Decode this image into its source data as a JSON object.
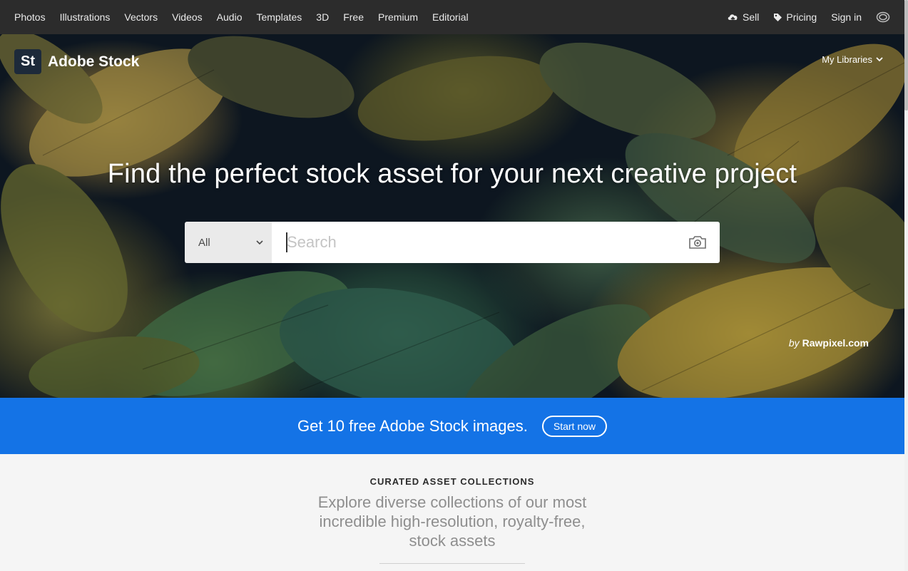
{
  "topnav": {
    "links": [
      "Photos",
      "Illustrations",
      "Vectors",
      "Videos",
      "Audio",
      "Templates",
      "3D",
      "Free",
      "Premium",
      "Editorial"
    ],
    "sell": "Sell",
    "pricing": "Pricing",
    "signin": "Sign in",
    "icons": {
      "sell": "cloud-upload-icon",
      "pricing": "tag-icon",
      "apps": "creative-cloud-icon"
    }
  },
  "brand": {
    "badge": "St",
    "name": "Adobe Stock"
  },
  "hero": {
    "my_libraries": "My Libraries",
    "headline": "Find the perfect stock asset for your next creative project",
    "credit_by": "by",
    "credit_name": "Rawpixel.com"
  },
  "search": {
    "filter_value": "All",
    "placeholder": "Search",
    "camera_icon": "camera-icon"
  },
  "promo": {
    "text": "Get 10 free Adobe Stock images.",
    "button": "Start now",
    "color": "#1473e6"
  },
  "curated": {
    "kicker": "CURATED ASSET COLLECTIONS",
    "description": "Explore diverse collections of our most incredible high-resolution, royalty-free, stock assets"
  }
}
